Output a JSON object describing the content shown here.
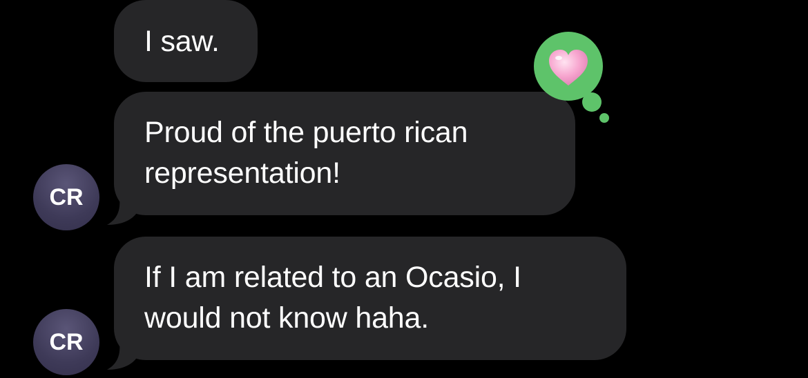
{
  "conversation": {
    "messages": [
      {
        "sender_initials": "",
        "text": "I saw."
      },
      {
        "sender_initials": "CR",
        "text": "Proud of the puerto rican\nrepresentation!",
        "reaction": "heart-icon"
      },
      {
        "sender_initials": "CR",
        "text": "If I am related to an Ocasio, I\nwould not know haha."
      }
    ]
  },
  "colors": {
    "background": "#000000",
    "bubble": "#262628",
    "text": "#ffffff",
    "tapback": "#5ec36a",
    "heart": "#f7a6cf"
  }
}
